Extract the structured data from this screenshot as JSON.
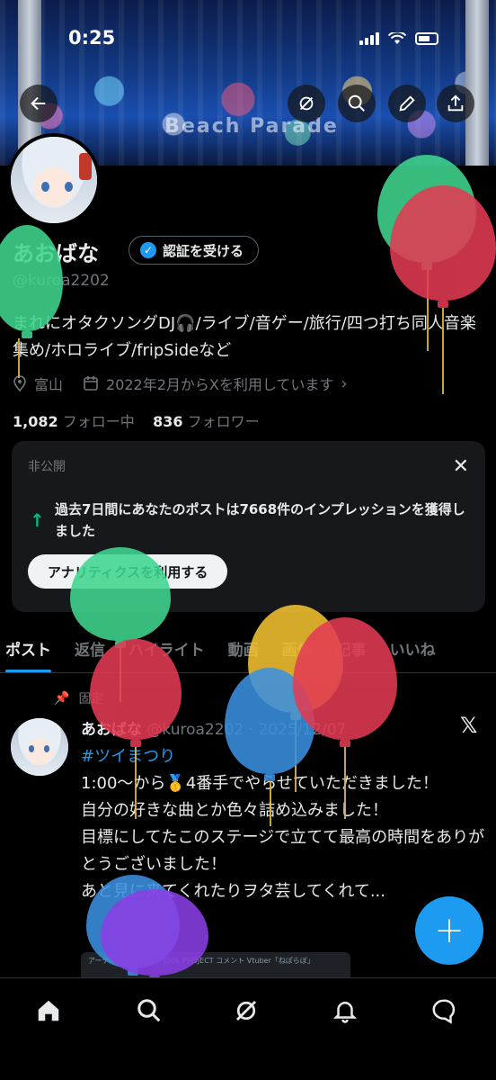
{
  "status_bar": {
    "time": "0:25"
  },
  "banner": {
    "stage_text": "Beach Parade"
  },
  "profile": {
    "display_name": "あおばな",
    "verify_label": "認証を受ける",
    "handle": "@kuroa2202",
    "bio": "まれにオタクソングDJ🎧/ライブ/音ゲー/旅行/四つ打ち同人音楽集め/ホロライブ/fripSideなど",
    "location": "富山",
    "joined": "2022年2月からXを利用しています",
    "following_count": "1,082",
    "following_label": "フォロー中",
    "followers_count": "836",
    "followers_label": "フォロワー"
  },
  "analytics_card": {
    "label": "非公開",
    "message": "過去7日間にあなたのポストは7668件のインプレッションを獲得しました",
    "cta": "アナリティクスを利用する"
  },
  "tabs": [
    "ポスト",
    "返信",
    "ハイライト",
    "動画",
    "画像",
    "記事",
    "いいね"
  ],
  "pinned_post": {
    "pinned_label": "固定",
    "author": "あおばな",
    "handle_date": "@kuroa2202 · 2025/12/07",
    "hashtag": "#ツイまつり",
    "lines": [
      "1:00〜から🥇4番手でやらせていただきました！",
      "自分の好きな曲とか色々詰め込みました！",
      "目標にしてたこのステージで立てて最高の時間をありがとうございました！",
      "あと見に来てくれたりヲタ芸してくれて..."
    ],
    "image_caption": "アーティスト  hololive IDOL PROJECT  コメント  Vtuber「ねぽらぼ」"
  },
  "icons": {
    "back": "back-arrow-icon",
    "grok": "grok-icon",
    "search": "search-icon",
    "edit": "pencil-icon",
    "share": "share-icon",
    "home": "home-icon",
    "notifications": "bell-icon",
    "messages": "message-icon"
  }
}
